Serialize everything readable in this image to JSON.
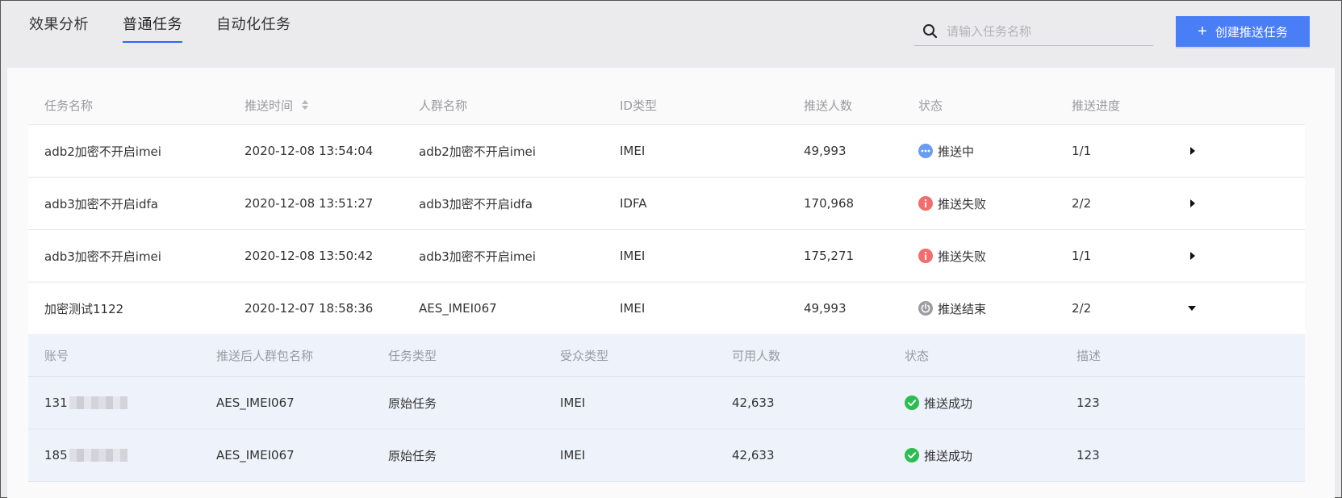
{
  "tabs": [
    {
      "label": "效果分析",
      "active": false
    },
    {
      "label": "普通任务",
      "active": true
    },
    {
      "label": "自动化任务",
      "active": false
    }
  ],
  "search": {
    "placeholder": "请输入任务名称",
    "value": ""
  },
  "create_button": {
    "label": "创建推送任务"
  },
  "table": {
    "headers": [
      "任务名称",
      "推送时间",
      "人群名称",
      "ID类型",
      "推送人数",
      "状态",
      "推送进度"
    ],
    "rows": [
      {
        "name": "adb2加密不开启imei",
        "time": "2020-12-08 13:54:04",
        "crowd": "adb2加密不开启imei",
        "id_type": "IMEI",
        "count": "49,993",
        "status": "推送中",
        "status_icon": "more-dots-icon",
        "progress": "1/1",
        "expanded": false
      },
      {
        "name": "adb3加密不开启idfa",
        "time": "2020-12-08 13:51:27",
        "crowd": "adb3加密不开启idfa",
        "id_type": "IDFA",
        "count": "170,968",
        "status": "推送失败",
        "status_icon": "error-info-icon",
        "progress": "2/2",
        "expanded": false
      },
      {
        "name": "adb3加密不开启imei",
        "time": "2020-12-08 13:50:42",
        "crowd": "adb3加密不开启imei",
        "id_type": "IMEI",
        "count": "175,271",
        "status": "推送失败",
        "status_icon": "error-info-icon",
        "progress": "1/1",
        "expanded": false
      },
      {
        "name": "加密测试1122",
        "time": "2020-12-07 18:58:36",
        "crowd": "AES_IMEI067",
        "id_type": "IMEI",
        "count": "49,993",
        "status": "推送结束",
        "status_icon": "power-icon",
        "progress": "2/2",
        "expanded": true
      }
    ]
  },
  "subtable": {
    "headers": [
      "账号",
      "推送后人群包名称",
      "任务类型",
      "受众类型",
      "可用人数",
      "状态",
      "描述"
    ],
    "rows": [
      {
        "account": "131",
        "package": "AES_IMEI067",
        "task_type": "原始任务",
        "audience": "IMEI",
        "available": "42,633",
        "status": "推送成功",
        "desc": "123"
      },
      {
        "account": "185",
        "package": "AES_IMEI067",
        "task_type": "原始任务",
        "audience": "IMEI",
        "available": "42,633",
        "status": "推送成功",
        "desc": "123"
      }
    ]
  },
  "colors": {
    "accent": "#4a7ef7",
    "tab_underline": "#2c67f2",
    "status_pending": "#6b9cf3",
    "status_failed": "#f26d6d",
    "status_ended": "#9c9ca3",
    "status_success": "#2bbd4f",
    "subtable_bg": "#eef3fb"
  }
}
